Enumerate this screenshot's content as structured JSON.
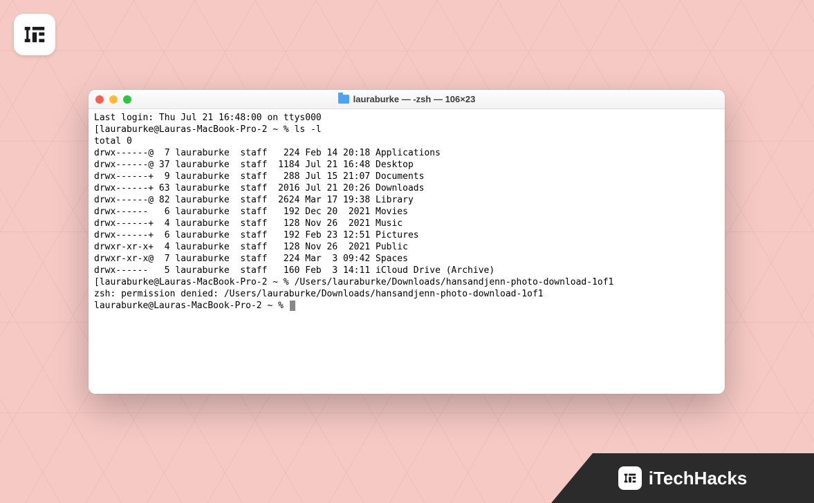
{
  "brand": {
    "name": "iTechHacks"
  },
  "window": {
    "title": "lauraburke — -zsh — 106×23"
  },
  "terminal": {
    "last_login": "Last login: Thu Jul 21 16:48:00 on ttys000",
    "prompt1_prefix": "[lauraburke@Lauras-MacBook-Pro-2 ~ % ",
    "cmd1": "ls -l",
    "total": "total 0",
    "listing": [
      "drwx------@  7 lauraburke  staff   224 Feb 14 20:18 Applications",
      "drwx------@ 37 lauraburke  staff  1184 Jul 21 16:48 Desktop",
      "drwx------+  9 lauraburke  staff   288 Jul 15 21:07 Documents",
      "drwx------+ 63 lauraburke  staff  2016 Jul 21 20:26 Downloads",
      "drwx------@ 82 lauraburke  staff  2624 Mar 17 19:38 Library",
      "drwx------   6 lauraburke  staff   192 Dec 20  2021 Movies",
      "drwx------+  4 lauraburke  staff   128 Nov 26  2021 Music",
      "drwx------+  6 lauraburke  staff   192 Feb 23 12:51 Pictures",
      "drwxr-xr-x+  4 lauraburke  staff   128 Nov 26  2021 Public",
      "drwxr-xr-x@  7 lauraburke  staff   224 Mar  3 09:42 Spaces",
      "drwx------   5 lauraburke  staff   160 Feb  3 14:11 iCloud Drive (Archive)"
    ],
    "prompt2_prefix": "[lauraburke@Lauras-MacBook-Pro-2 ~ % ",
    "cmd2": "/Users/lauraburke/Downloads/hansandjenn-photo-download-1of1",
    "error": "zsh: permission denied: /Users/lauraburke/Downloads/hansandjenn-photo-download-1of1",
    "prompt3": "lauraburke@Lauras-MacBook-Pro-2 ~ % "
  }
}
